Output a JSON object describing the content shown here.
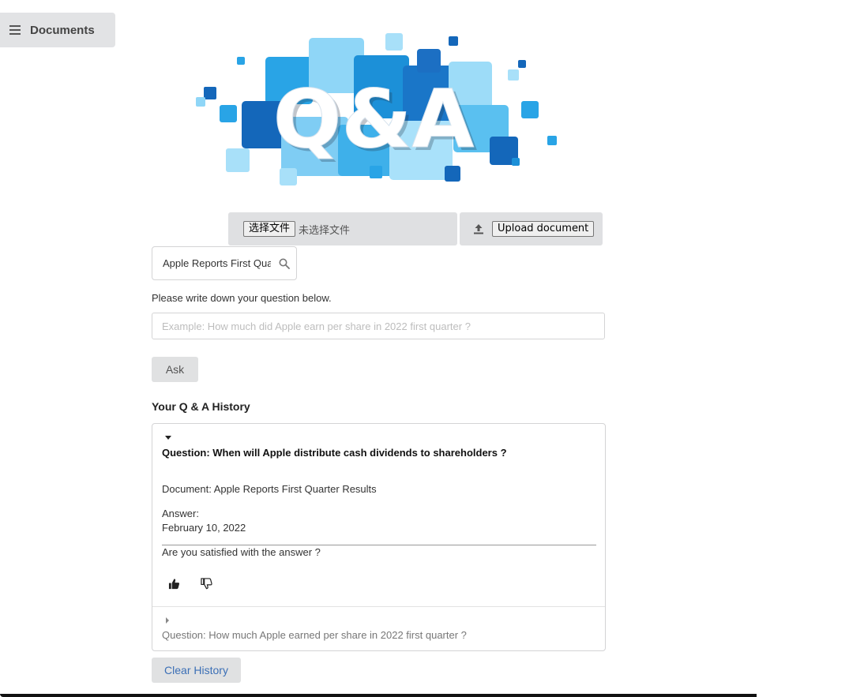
{
  "sidebar": {
    "toggle_label": "Documents",
    "icon": "hamburger-icon"
  },
  "logo": {
    "text": "Q&A"
  },
  "upload": {
    "choose_file_label": "选择文件",
    "file_status": "未选择文件",
    "upload_label": "Upload document",
    "upload_icon": "upload-icon"
  },
  "document_search": {
    "value": "Apple Reports First Quarter Results",
    "icon": "search-icon"
  },
  "question": {
    "label": "Please write down your question below.",
    "placeholder": "Example: How much did Apple earn per share in 2022 first quarter ?"
  },
  "ask_label": "Ask",
  "history": {
    "title": "Your Q & A History",
    "items": [
      {
        "question": "Question: When will Apple distribute cash dividends to shareholders ?",
        "document": "Document: Apple Reports First Quarter Results",
        "answer_label": "Answer:",
        "answer": "February 10, 2022",
        "feedback_prompt": "Are you satisfied with the answer ?",
        "expanded": true
      },
      {
        "question": "Question: How much Apple earned per share in 2022 first quarter ?",
        "expanded": false
      }
    ]
  },
  "clear_label": "Clear History",
  "colors": {
    "accent_link": "#3b6fb6",
    "button_bg": "#e0e1e2",
    "logo_blue": "#1a8fd6"
  }
}
